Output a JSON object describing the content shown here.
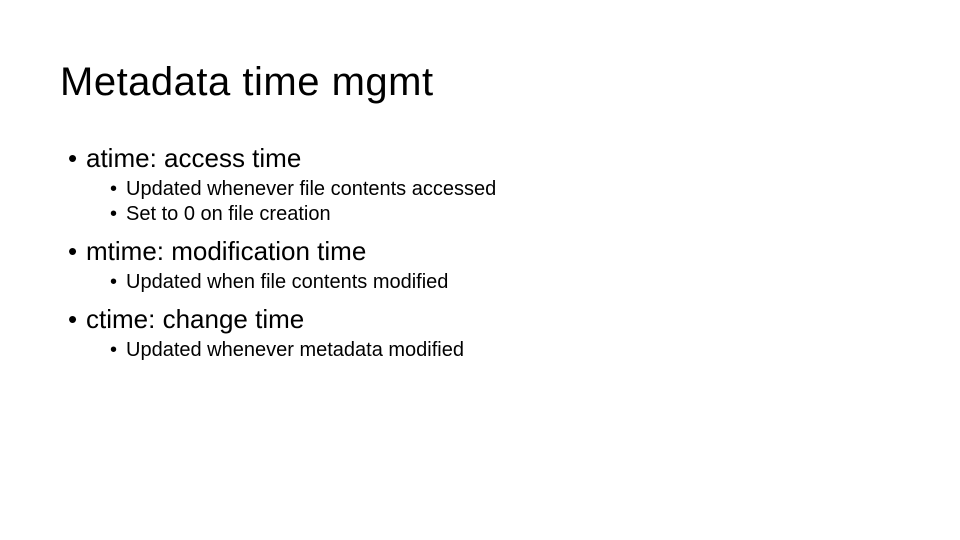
{
  "title": "Metadata time mgmt",
  "items": [
    {
      "text": "atime: access time",
      "sub": [
        "Updated whenever file contents accessed",
        "Set to 0 on file creation"
      ]
    },
    {
      "text": "mtime: modification time",
      "sub": [
        "Updated when file contents modified"
      ]
    },
    {
      "text": "ctime: change time",
      "sub": [
        "Updated whenever metadata modified"
      ]
    }
  ]
}
